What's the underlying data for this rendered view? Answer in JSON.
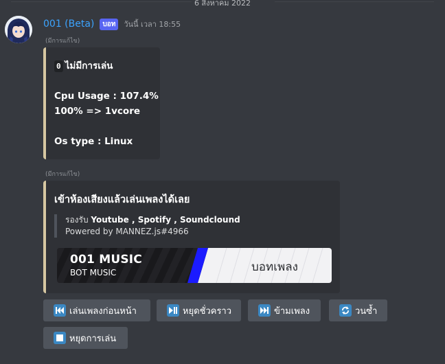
{
  "date_divider": "6 สิงหาคม 2022",
  "message": {
    "username": "001 (Beta)",
    "bot_tag": "บอท",
    "timestamp": "วันนี้ เวลา 18:55",
    "edited_label": "(มีการแก้ไข)"
  },
  "embed1": {
    "chip": "0",
    "status": "ไม่มีการเล่น",
    "cpu_usage": "Cpu Usage : 107.4%",
    "cpu_note": "100% => 1vcore",
    "os_type": "Os type : Linux"
  },
  "embed2": {
    "edited_label": "(มีการแก้ไข)",
    "title": "เข้าห้องเสียงแล้วเล่นเพลงได้เลย",
    "support_prefix": "รองรับ",
    "support_services": "Youtube , Spotify , Soundclound",
    "powered_by": "Powered by MANNEZ.js#4966",
    "banner": {
      "title": "001 MUSIC",
      "subtitle": "BOT MUSIC",
      "label": "บอทเพลง"
    }
  },
  "buttons": {
    "previous": {
      "label": "เล่นเพลงก่อนหน้า",
      "icon": "previous-track-icon"
    },
    "pause": {
      "label": "หยุดชั่วคราว",
      "icon": "play-pause-icon"
    },
    "skip": {
      "label": "ข้ามเพลง",
      "icon": "next-track-icon"
    },
    "loop": {
      "label": "วนซ้ำ",
      "icon": "repeat-icon"
    },
    "stop": {
      "label": "หยุดการเล่น",
      "icon": "stop-icon"
    }
  },
  "colors": {
    "background": "#36393f",
    "embed": "#2f3136",
    "embed_border": "#d6c7a1",
    "button": "#4f545c",
    "username": "#3ca4ff",
    "bot_tag": "#5865f2",
    "emoji_blue": "#3b88c3"
  }
}
